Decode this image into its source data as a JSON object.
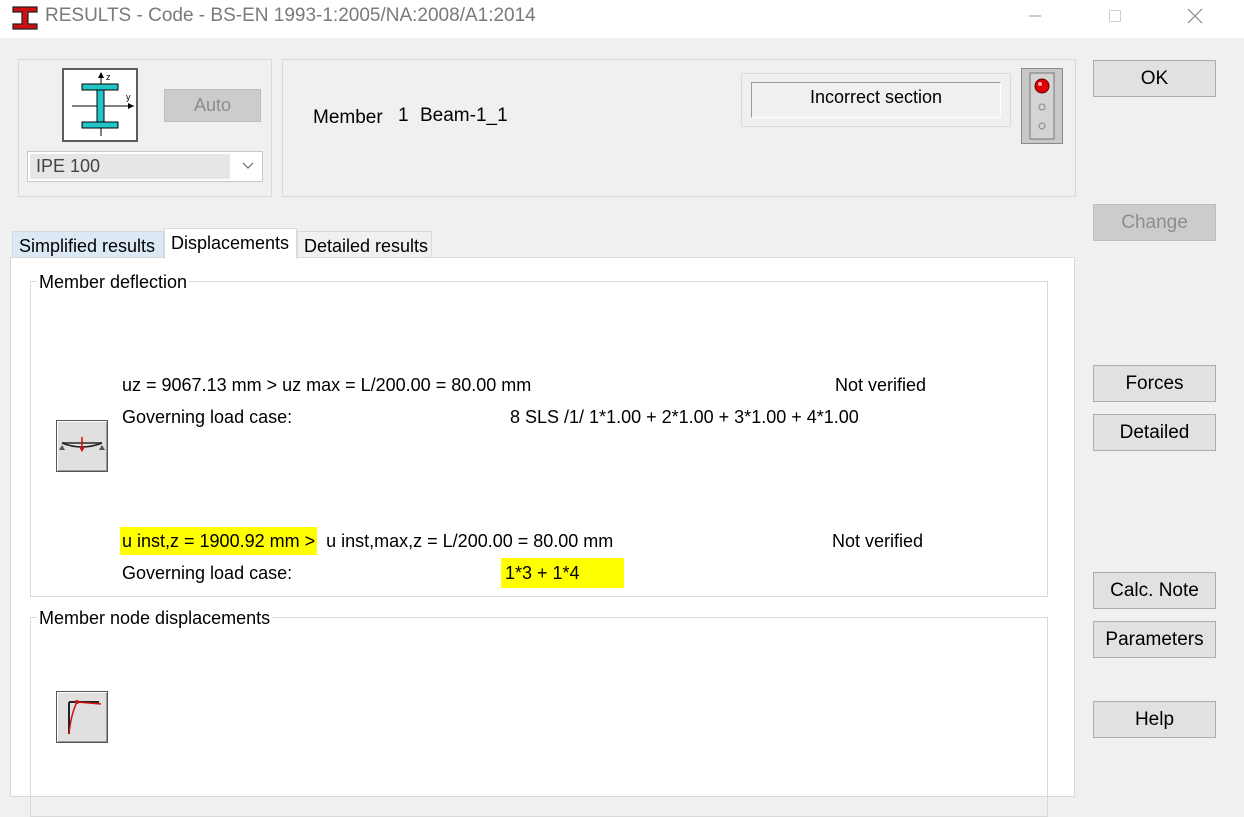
{
  "window": {
    "title": "RESULTS - Code - BS-EN 1993-1:2005/NA:2008/A1:2014",
    "icons": {
      "app": "steel-beam-app-icon",
      "minimize": "minimize-icon",
      "maximize": "maximize-icon",
      "close": "close-icon"
    }
  },
  "section": {
    "auto_label": "Auto",
    "selected": "IPE 100",
    "thumbnail_icon": "i-section-icon"
  },
  "member": {
    "label": "Member",
    "number": "1",
    "name": "Beam-1_1"
  },
  "status": {
    "text": "Incorrect section",
    "light": "red"
  },
  "tabs": [
    {
      "label": "Simplified results"
    },
    {
      "label": "Displacements"
    },
    {
      "label": "Detailed results"
    }
  ],
  "deflection": {
    "title": "Member deflection",
    "uz_line": "uz = 9067.13 mm  >  uz max = L/200.00 = 80.00 mm",
    "uz_status": "Not verified",
    "uz_case_label": "Governing load case:",
    "uz_case_value": "8 SLS /1/  1*1.00 + 2*1.00 + 3*1.00 + 4*1.00",
    "inst_line_hl": "u inst,z = 1900.92 mm  >",
    "inst_line_rest": "u inst,max,z = L/200.00 = 80.00 mm",
    "inst_status": "Not verified",
    "inst_case_label": "Governing load case:",
    "inst_case_value": "1*3 + 1*4"
  },
  "node_displacements": {
    "title": "Member node displacements"
  },
  "buttons": {
    "ok": "OK",
    "change": "Change",
    "forces": "Forces",
    "detailed": "Detailed",
    "calc_note": "Calc. Note",
    "parameters": "Parameters",
    "help": "Help"
  },
  "colors": {
    "highlight": "#ffff00",
    "status_red": "#e00000",
    "tab_inactive_blue": "#dce9f5"
  }
}
